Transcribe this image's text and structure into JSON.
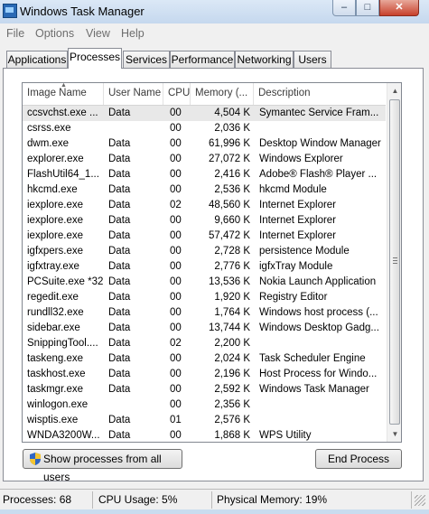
{
  "window": {
    "title": "Windows Task Manager",
    "controls": {
      "minimize": "–",
      "maximize": "□",
      "close": "✕"
    }
  },
  "menu": [
    "File",
    "Options",
    "View",
    "Help"
  ],
  "tabs": [
    "Applications",
    "Processes",
    "Services",
    "Performance",
    "Networking",
    "Users"
  ],
  "active_tab": "Processes",
  "columns": [
    "Image Name",
    "User Name",
    "CPU",
    "Memory (...",
    "Description"
  ],
  "sort_column": "Image Name",
  "processes": [
    {
      "name": "ccsvchst.exe ...",
      "user": "Data",
      "cpu": "00",
      "memory": "4,504 K",
      "description": "Symantec Service Fram..."
    },
    {
      "name": "csrss.exe",
      "user": "",
      "cpu": "00",
      "memory": "2,036 K",
      "description": ""
    },
    {
      "name": "dwm.exe",
      "user": "Data",
      "cpu": "00",
      "memory": "61,996 K",
      "description": "Desktop Window Manager"
    },
    {
      "name": "explorer.exe",
      "user": "Data",
      "cpu": "00",
      "memory": "27,072 K",
      "description": "Windows Explorer"
    },
    {
      "name": "FlashUtil64_1...",
      "user": "Data",
      "cpu": "00",
      "memory": "2,416 K",
      "description": "Adobe® Flash® Player ..."
    },
    {
      "name": "hkcmd.exe",
      "user": "Data",
      "cpu": "00",
      "memory": "2,536 K",
      "description": "hkcmd Module"
    },
    {
      "name": "iexplore.exe",
      "user": "Data",
      "cpu": "02",
      "memory": "48,560 K",
      "description": "Internet Explorer"
    },
    {
      "name": "iexplore.exe",
      "user": "Data",
      "cpu": "00",
      "memory": "9,660 K",
      "description": "Internet Explorer"
    },
    {
      "name": "iexplore.exe",
      "user": "Data",
      "cpu": "00",
      "memory": "57,472 K",
      "description": "Internet Explorer"
    },
    {
      "name": "igfxpers.exe",
      "user": "Data",
      "cpu": "00",
      "memory": "2,728 K",
      "description": "persistence Module"
    },
    {
      "name": "igfxtray.exe",
      "user": "Data",
      "cpu": "00",
      "memory": "2,776 K",
      "description": "igfxTray Module"
    },
    {
      "name": "PCSuite.exe *32",
      "user": "Data",
      "cpu": "00",
      "memory": "13,536 K",
      "description": "Nokia Launch Application"
    },
    {
      "name": "regedit.exe",
      "user": "Data",
      "cpu": "00",
      "memory": "1,920 K",
      "description": "Registry Editor"
    },
    {
      "name": "rundll32.exe",
      "user": "Data",
      "cpu": "00",
      "memory": "1,764 K",
      "description": "Windows host process (..."
    },
    {
      "name": "sidebar.exe",
      "user": "Data",
      "cpu": "00",
      "memory": "13,744 K",
      "description": "Windows Desktop Gadg..."
    },
    {
      "name": "SnippingTool....",
      "user": "Data",
      "cpu": "02",
      "memory": "2,200 K",
      "description": ""
    },
    {
      "name": "taskeng.exe",
      "user": "Data",
      "cpu": "00",
      "memory": "2,024 K",
      "description": "Task Scheduler Engine"
    },
    {
      "name": "taskhost.exe",
      "user": "Data",
      "cpu": "00",
      "memory": "2,196 K",
      "description": "Host Process for Windo..."
    },
    {
      "name": "taskmgr.exe",
      "user": "Data",
      "cpu": "00",
      "memory": "2,592 K",
      "description": "Windows Task Manager"
    },
    {
      "name": "winlogon.exe",
      "user": "",
      "cpu": "00",
      "memory": "2,356 K",
      "description": ""
    },
    {
      "name": "wisptis.exe",
      "user": "Data",
      "cpu": "01",
      "memory": "2,576 K",
      "description": ""
    },
    {
      "name": "WNDA3200W...",
      "user": "Data",
      "cpu": "00",
      "memory": "1,868 K",
      "description": "WPS Utility"
    }
  ],
  "selected_index": 0,
  "buttons": {
    "show_all": "Show processes from all users",
    "end_process": "End Process"
  },
  "status": {
    "processes": "Processes: 68",
    "cpu": "CPU Usage: 5%",
    "memory": "Physical Memory: 19%"
  },
  "icons": {
    "app": "task-manager-icon",
    "shield": "uac-shield-icon",
    "grip": "resize-grip-icon"
  }
}
